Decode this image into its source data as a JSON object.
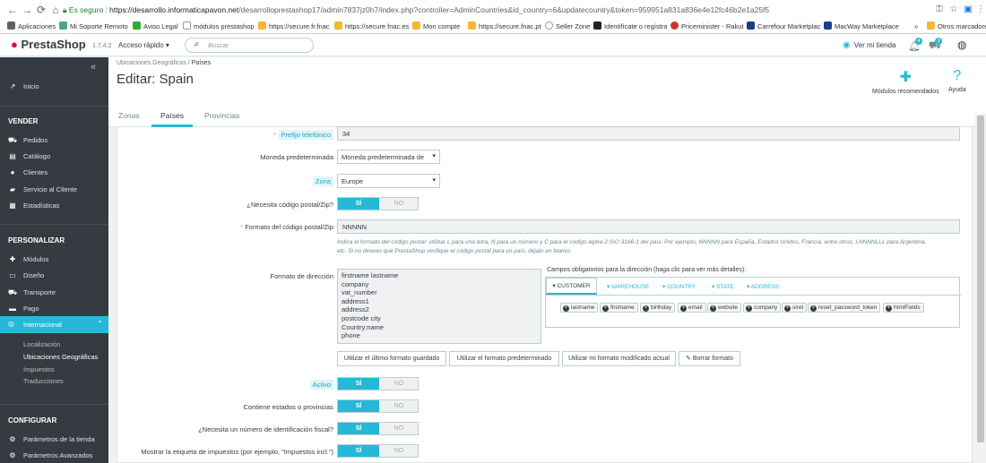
{
  "browser": {
    "secure_label": "Es seguro",
    "url_domain": "https://desarrollo.informaticapavon.net",
    "url_path": "/desarrolloprestashop17/admin7837jz0h7/index.php?controller=AdminCountries&id_country=6&updatecountry&token=959951a831a836e4e12fc46b2e1a25f5",
    "bookmarks": [
      "Aplicaciones",
      "Mi Soporte Remoto",
      "Aviso Legal",
      "módulos prestashop",
      "https://secure.fr.fnac",
      "https://secure.fnac.es",
      "Mon compte",
      "https://secure.fnac.pt",
      "Seller Zone",
      "Identifícate o regístra",
      "Priceminister - Rakut",
      "Carrefour Marketplac",
      "MacWay Marketplace"
    ],
    "other_bookmarks": "Otros marcadores"
  },
  "topbar": {
    "logo": "PrestaShop",
    "version": "1.7.4.2",
    "quick_access": "Acceso rápido ▾",
    "search_placeholder": "Buscar",
    "view_shop": "Ver mi tienda",
    "notif_count": "4",
    "orders_count": "3"
  },
  "sidebar": {
    "collapse": "«",
    "inicio": "Inicio",
    "sections": [
      "VENDER",
      "PERSONALIZAR",
      "CONFIGURAR"
    ],
    "vender_items": [
      "Pedidos",
      "Catálogo",
      "Clientes",
      "Servicio al Cliente",
      "Estadísticas"
    ],
    "personalizar_items": [
      "Módulos",
      "Diseño",
      "Transporte",
      "Pago",
      "Internacional"
    ],
    "internacional_sub": [
      "Localización",
      "Ubicaciones Geográficas",
      "Impuestos",
      "Traducciones"
    ],
    "configurar_items": [
      "Parámetros de la tienda",
      "Parámetros Avanzados"
    ]
  },
  "header": {
    "breadcrumb_parent": "Ubicaciones Geográficas",
    "breadcrumb_sep": "/",
    "breadcrumb_current": "Países",
    "title": "Editar: Spain",
    "recommended_modules": "Módulos recomendados",
    "help": "Ayuda",
    "tabs": [
      "Zonas",
      "Países",
      "Provincias"
    ]
  },
  "form": {
    "phone_prefix_label": "Prefijo telefónico",
    "phone_prefix_value": "34",
    "currency_label": "Moneda predeterminada",
    "currency_value": "Moneda predeterminada de",
    "zone_label": "Zona",
    "zone_value": "Europe",
    "needs_zip_label": "¿Necesita código postal/Zip?",
    "zip_format_label": "Formato del código postal/Zip",
    "zip_format_value": "NNNNN",
    "zip_help_1": "Indica el formato del código postal: utilizar L para una letra, N para un número y C para el código alpha-2 ISO 3166-1 del país. Por ejemplo, NNNNN para España, Estados Unidos, Francia, entre otros; LNNNNLLL para Argentina,",
    "zip_help_2": "etc. Si no deseas que PrestaShop verifique el código postal para un país, déjalo en blanco.",
    "address_format_label": "Formato de dirección",
    "address_lines": [
      "firstname lastname",
      "company",
      "vat_number",
      "address1",
      "address2",
      "postcode city",
      "Country:name",
      "phone"
    ],
    "required_fields_label": "Campos obligatorios para la dirección (haga clic para ver más detalles):",
    "field_tabs": [
      "▾ CUSTOMER",
      "▾ WAREHOUSE",
      "▾ COUNTRY",
      "▾ STATE",
      "▾ ADDRESS"
    ],
    "field_chips": [
      "lastname",
      "firstname",
      "birthday",
      "email",
      "website",
      "company",
      "siret",
      "reset_password_token",
      "htmlFields"
    ],
    "buttons": [
      "Utilizar el último formato guardado",
      "Utilizar el formato predeterminado",
      "Utilizar mi formato modificado actual",
      "Borrar formato"
    ],
    "active_label": "Activo",
    "contains_states_label": "Contiene estados o provincias",
    "needs_id_label": "¿Necesita un número de identificación fiscal?",
    "show_tax_label": "Mostrar la etiqueta de impuestos (por ejemplo, \"Impuestos incl.\")",
    "yes": "SÍ",
    "no": "NO"
  },
  "colors": {
    "accent": "#25b9d7",
    "sidebar": "#363a41",
    "required": "#e08f95"
  },
  "icons": [
    "back-arrow-icon",
    "forward-arrow-icon",
    "reload-icon",
    "home-icon",
    "lock-icon",
    "search-icon",
    "eye-icon",
    "bell-icon",
    "cart-icon",
    "user-icon",
    "puzzle-icon",
    "question-icon",
    "chart-icon",
    "cart-small-icon",
    "book-icon",
    "person-icon",
    "chat-icon",
    "stats-icon",
    "puzzle-small-icon",
    "monitor-icon",
    "truck-icon",
    "card-icon",
    "globe-icon",
    "gear-icon",
    "cogs-icon"
  ]
}
